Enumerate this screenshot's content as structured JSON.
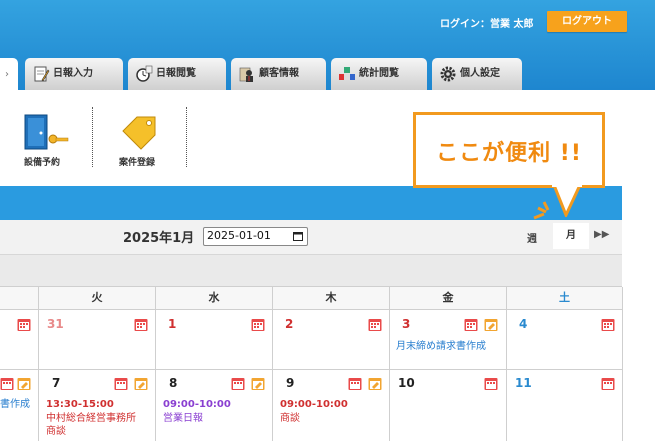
{
  "header": {
    "login_label": "ログイン：営業 太郎",
    "logout_label": "ログアウト"
  },
  "tabs": [
    {
      "label": "日報入力",
      "icon": "pencil-document-icon"
    },
    {
      "label": "日報閲覧",
      "icon": "clock-magnifier-icon"
    },
    {
      "label": "顧客情報",
      "icon": "customer-folder-icon"
    },
    {
      "label": "統計閲覧",
      "icon": "stats-blocks-icon"
    },
    {
      "label": "個人設定",
      "icon": "gear-icon"
    }
  ],
  "toolbar": {
    "facility_label": "設備予約",
    "project_label": "案件登録"
  },
  "callout": {
    "text": "ここが便利 !!"
  },
  "calendar": {
    "title": "2025年1月",
    "date_value": "2025-01-01",
    "view_week": "週",
    "view_month": "月",
    "next_icon": "double-chevron-right-icon",
    "weekdays": [
      "火",
      "水",
      "木",
      "金",
      "土"
    ],
    "row1": {
      "d31": "31",
      "d1": "1",
      "d2": "2",
      "d3": "3",
      "d4": "4",
      "fri_event": "月末締め請求書作成",
      "mon_partial": "書作成"
    },
    "row2": {
      "d7": "7",
      "d8": "8",
      "d9": "9",
      "d10": "10",
      "d11": "11",
      "tue_time": "13:30-15:00",
      "tue_text1": "中村総合経営事務所",
      "tue_text2": "商談",
      "wed_time": "09:00-10:00",
      "wed_text": "営業日報",
      "thu_time": "09:00-10:00",
      "thu_text": "商談"
    }
  },
  "colors": {
    "header_blue": "#1e86cf",
    "accent_orange": "#f29a1f",
    "holiday_red": "#d03030",
    "saturday_blue": "#2a8acf",
    "event_purple": "#8a3fd1"
  }
}
